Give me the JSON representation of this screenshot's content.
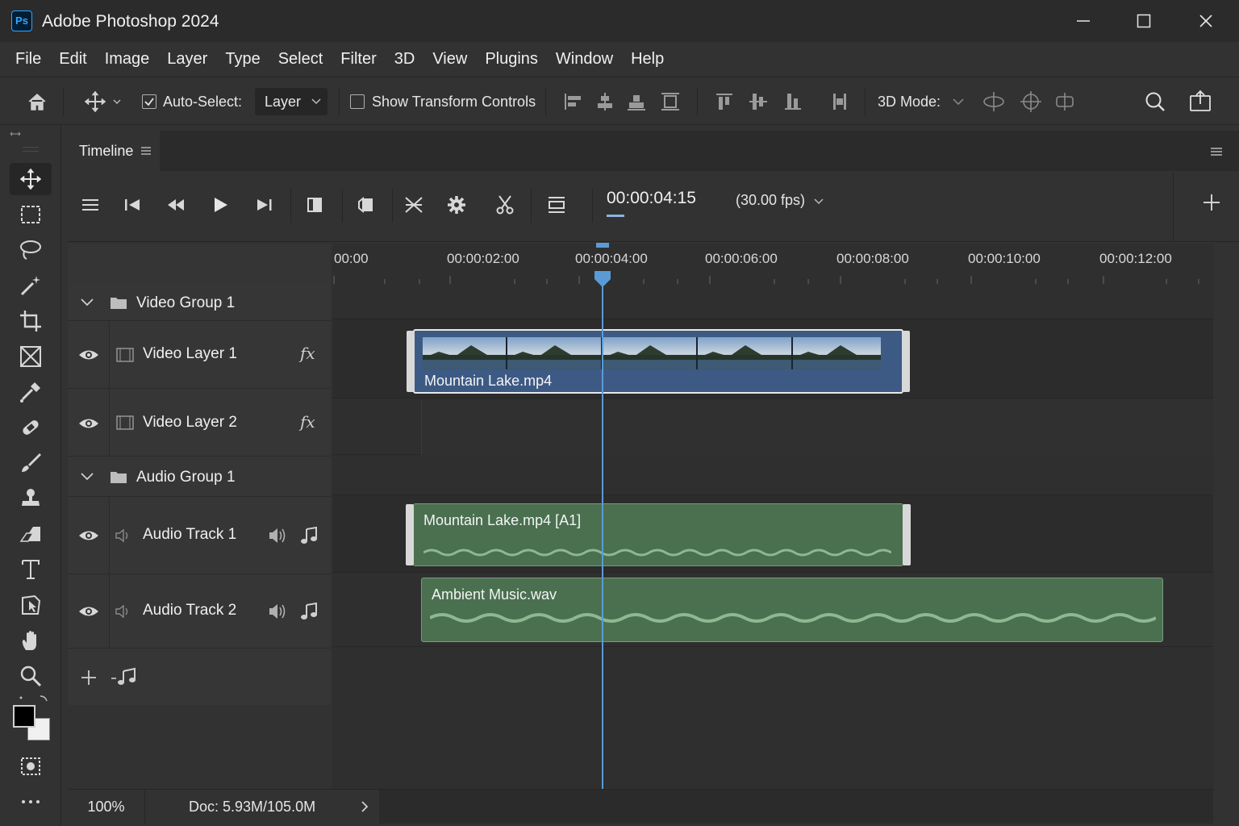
{
  "app": {
    "title": "Adobe Photoshop 2024",
    "logo_text": "Ps"
  },
  "menu": [
    "File",
    "Edit",
    "Image",
    "Layer",
    "Type",
    "Select",
    "Filter",
    "3D",
    "View",
    "Plugins",
    "Window",
    "Help"
  ],
  "options_bar": {
    "auto_select_label": "Auto-Select:",
    "auto_select_checked": true,
    "auto_select_target": "Layer",
    "show_transform_label": "Show Transform Controls",
    "show_transform_checked": false,
    "mode_3d_label": "3D Mode:"
  },
  "panel": {
    "tab_label": "Timeline"
  },
  "timeline": {
    "current_time": "00:00:04:15",
    "fps": "(30.00 fps)",
    "ruler_labels": [
      "00:00",
      "00:00:02:00",
      "00:00:04:00",
      "00:00:06:00",
      "00:00:08:00",
      "00:00:10:00",
      "00:00:12:00"
    ],
    "groups": [
      {
        "name": "Video Group 1"
      },
      {
        "name": "Audio Group 1"
      }
    ],
    "layers": [
      {
        "name": "Video Layer 1",
        "type": "video",
        "fx": "fx"
      },
      {
        "name": "Video Layer 2",
        "type": "video",
        "fx": "fx"
      },
      {
        "name": "Audio Track 1",
        "type": "audio"
      },
      {
        "name": "Audio Track 2",
        "type": "audio"
      }
    ],
    "clips": {
      "video": "Mountain Lake.mp4",
      "audio1": "Mountain Lake.mp4 [A1]",
      "audio2": "Ambient Music.wav"
    }
  },
  "status": {
    "zoom": "100%",
    "doc": "Doc: 5.93M/105.0M"
  },
  "colors": {
    "accent": "#5b9bd5",
    "video_clip": "#3d5a85",
    "audio_clip": "#4a7050"
  }
}
